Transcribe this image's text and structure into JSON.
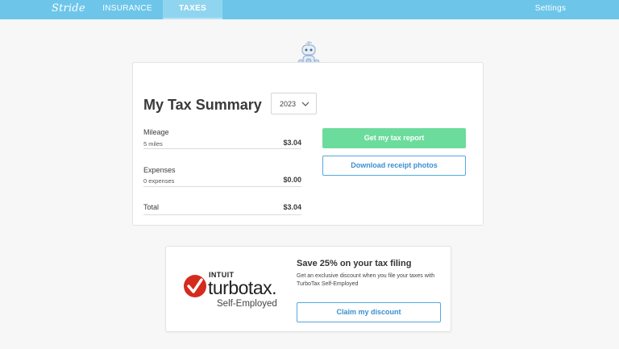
{
  "nav": {
    "logo": "Stride",
    "tabs": [
      {
        "label": "INSURANCE",
        "active": false
      },
      {
        "label": "TAXES",
        "active": true
      }
    ],
    "settings_label": "Settings"
  },
  "colors": {
    "nav_bg": "#6dc6ea",
    "primary_button": "#6bdc9c",
    "outline_button": "#54a8e0",
    "turbotax_red": "#d52b1e"
  },
  "summary": {
    "title": "My Tax Summary",
    "year": "2023",
    "rows": [
      {
        "label": "Mileage",
        "sub": "5 miles",
        "value": "$3.04"
      },
      {
        "label": "Expenses",
        "sub": "0 expenses",
        "value": "$0.00"
      },
      {
        "label": "Total",
        "sub": "",
        "value": "$3.04"
      }
    ],
    "get_report_label": "Get my tax report",
    "download_label": "Download receipt photos"
  },
  "promo": {
    "logo": {
      "intuit": "INTUIT",
      "brand": "turbotax.",
      "product": "Self-Employed"
    },
    "title": "Save 25% on your tax filing",
    "text": "Get an exclusive discount when you file your taxes with TurboTax Self-Employed",
    "claim_label": "Claim my discount"
  },
  "icons": {
    "robot": "robot-mascot-icon",
    "chevron": "chevron-down-icon",
    "turbotax_check": "checkmark-circle-icon"
  }
}
